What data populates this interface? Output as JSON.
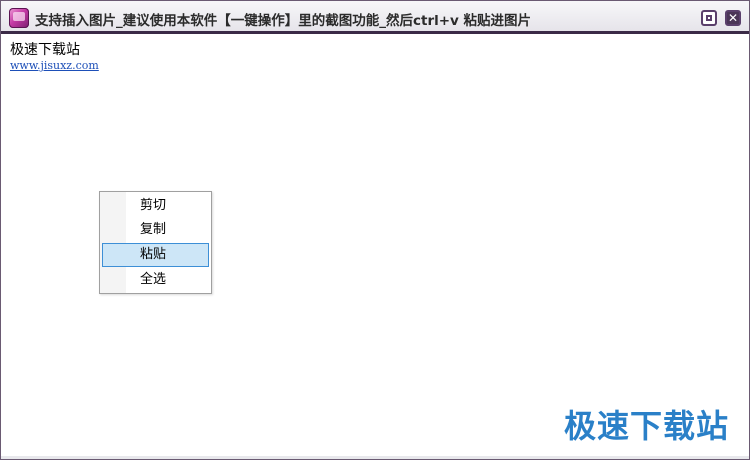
{
  "window": {
    "title": "支持插入图片_建议使用本软件【一键操作】里的截图功能_然后ctrl+v 粘贴进图片",
    "maximize_label": "□",
    "close_label": "✕"
  },
  "content": {
    "site_name": "极速下载站",
    "site_url": "www.jisuxz.com"
  },
  "context_menu": {
    "items": [
      {
        "label": "剪切",
        "highlighted": false
      },
      {
        "label": "复制",
        "highlighted": false
      },
      {
        "label": "粘贴",
        "highlighted": true
      },
      {
        "label": "全选",
        "highlighted": false
      }
    ]
  },
  "watermark": {
    "text": "极速下载站"
  },
  "colors": {
    "titlebar_border": "#3b2a47",
    "highlight_bg": "#cde6f7",
    "highlight_border": "#3d8fd6",
    "link": "#1d4fb8",
    "watermark": "#2a80c8"
  },
  "icons": {
    "app": "app-icon",
    "maximize": "maximize-icon",
    "close": "close-icon"
  }
}
